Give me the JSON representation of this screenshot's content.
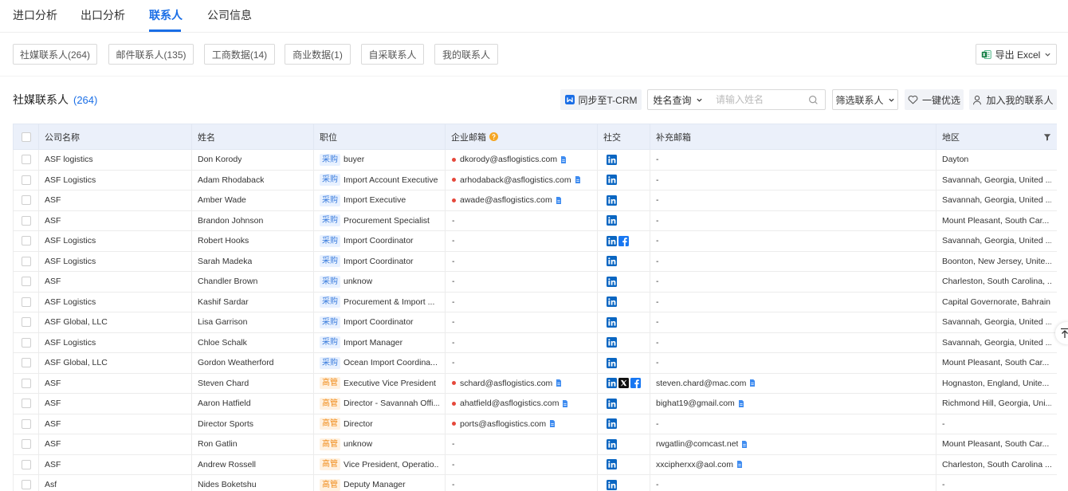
{
  "tabs": [
    {
      "label": "进口分析",
      "active": false
    },
    {
      "label": "出口分析",
      "active": false
    },
    {
      "label": "联系人",
      "active": true
    },
    {
      "label": "公司信息",
      "active": false
    }
  ],
  "filters": [
    "社媒联系人(264)",
    "邮件联系人(135)",
    "工商数据(14)",
    "商业数据(1)",
    "自采联系人",
    "我的联系人"
  ],
  "export": {
    "label": "导出 Excel",
    "icon": "excel-icon"
  },
  "section": {
    "title": "社媒联系人",
    "count": "(264)"
  },
  "toolbar": {
    "sync_label": "同步至T-CRM",
    "sync_icon": "sync-icon",
    "search_mode": "姓名查询",
    "search_placeholder": "请输入姓名",
    "search_icon": "search-icon",
    "filter_label": "筛选联系人",
    "optimize_label": "一键优选",
    "optimize_icon": "heart-icon",
    "add_label": "加入我的联系人",
    "add_icon": "user-icon"
  },
  "colors": {
    "primary": "#1a6ee6",
    "header_bg": "#ebf0fa",
    "email_dot": "#e5483b",
    "info_icon": "#f5a623",
    "copy_icon": "#3f8cf0"
  },
  "tag_styles": {
    "采购": {
      "bg": "#e8f1ff",
      "fg": "#3b7ddd"
    },
    "高管": {
      "bg": "#fff1e0",
      "fg": "#f08c1a"
    }
  },
  "table": {
    "columns": [
      "公司名称",
      "姓名",
      "职位",
      "企业邮箱",
      "社交",
      "补充邮箱",
      "地区"
    ],
    "rows": [
      {
        "company": "ASF logistics",
        "name": "Don Korody",
        "tag": "采购",
        "position": "buyer",
        "email": "dkorody@asflogistics.com",
        "social": [
          "linkedin"
        ],
        "extra_email": "-",
        "region": "Dayton"
      },
      {
        "company": "ASF Logistics",
        "name": "Adam Rhodaback",
        "tag": "采购",
        "position": "Import Account Executive",
        "email": "arhodaback@asflogistics.com",
        "social": [
          "linkedin"
        ],
        "extra_email": "-",
        "region": "Savannah, Georgia, United ..."
      },
      {
        "company": "ASF",
        "name": "Amber Wade",
        "tag": "采购",
        "position": "Import Executive",
        "email": "awade@asflogistics.com",
        "social": [
          "linkedin"
        ],
        "extra_email": "-",
        "region": "Savannah, Georgia, United ..."
      },
      {
        "company": "ASF",
        "name": "Brandon Johnson",
        "tag": "采购",
        "position": "Procurement Specialist",
        "email": "-",
        "social": [
          "linkedin"
        ],
        "extra_email": "-",
        "region": "Mount Pleasant, South Car..."
      },
      {
        "company": "ASF Logistics",
        "name": "Robert Hooks",
        "tag": "采购",
        "position": "Import Coordinator",
        "email": "-",
        "social": [
          "linkedin",
          "facebook"
        ],
        "extra_email": "-",
        "region": "Savannah, Georgia, United ..."
      },
      {
        "company": "ASF Logistics",
        "name": "Sarah Madeka",
        "tag": "采购",
        "position": "Import Coordinator",
        "email": "-",
        "social": [
          "linkedin"
        ],
        "extra_email": "-",
        "region": "Boonton, New Jersey, Unite..."
      },
      {
        "company": "ASF",
        "name": "Chandler Brown",
        "tag": "采购",
        "position": "unknow",
        "email": "-",
        "social": [
          "linkedin"
        ],
        "extra_email": "-",
        "region": "Charleston, South Carolina, ..."
      },
      {
        "company": "ASF Logistics",
        "name": "Kashif Sardar",
        "tag": "采购",
        "position": "Procurement & Import ...",
        "email": "-",
        "social": [
          "linkedin"
        ],
        "extra_email": "-",
        "region": "Capital Governorate, Bahrain"
      },
      {
        "company": "ASF Global, LLC",
        "name": "Lisa Garrison",
        "tag": "采购",
        "position": "Import Coordinator",
        "email": "-",
        "social": [
          "linkedin"
        ],
        "extra_email": "-",
        "region": "Savannah, Georgia, United ..."
      },
      {
        "company": "ASF Logistics",
        "name": "Chloe Schalk",
        "tag": "采购",
        "position": "Import Manager",
        "email": "-",
        "social": [
          "linkedin"
        ],
        "extra_email": "-",
        "region": "Savannah, Georgia, United ..."
      },
      {
        "company": "ASF Global, LLC",
        "name": "Gordon Weatherford",
        "tag": "采购",
        "position": "Ocean Import Coordina...",
        "email": "-",
        "social": [
          "linkedin"
        ],
        "extra_email": "-",
        "region": "Mount Pleasant, South Car..."
      },
      {
        "company": "ASF",
        "name": "Steven Chard",
        "tag": "高管",
        "position": "Executive Vice President",
        "email": "schard@asflogistics.com",
        "social": [
          "linkedin",
          "x",
          "facebook"
        ],
        "extra_email": "steven.chard@mac.com",
        "region": "Hognaston, England, Unite..."
      },
      {
        "company": "ASF",
        "name": "Aaron Hatfield",
        "tag": "高管",
        "position": "Director - Savannah Offi...",
        "email": "ahatfield@asflogistics.com",
        "social": [
          "linkedin"
        ],
        "extra_email": "bighat19@gmail.com",
        "region": "Richmond Hill, Georgia, Uni..."
      },
      {
        "company": "ASF",
        "name": "Director Sports",
        "tag": "高管",
        "position": "Director",
        "email": "ports@asflogistics.com",
        "social": [
          "linkedin"
        ],
        "extra_email": "-",
        "region": "-"
      },
      {
        "company": "ASF",
        "name": "Ron Gatlin",
        "tag": "高管",
        "position": "unknow",
        "email": "-",
        "social": [
          "linkedin"
        ],
        "extra_email": "rwgatlin@comcast.net",
        "region": "Mount Pleasant, South Car..."
      },
      {
        "company": "ASF",
        "name": "Andrew Rossell",
        "tag": "高管",
        "position": "Vice President, Operatio...",
        "email": "-",
        "social": [
          "linkedin"
        ],
        "extra_email": "xxcipherxx@aol.com",
        "region": "Charleston, South Carolina ..."
      },
      {
        "company": "Asf",
        "name": "Nides Boketshu",
        "tag": "高管",
        "position": "Deputy Manager",
        "email": "-",
        "social": [
          "linkedin"
        ],
        "extra_email": "-",
        "region": "-"
      }
    ]
  }
}
